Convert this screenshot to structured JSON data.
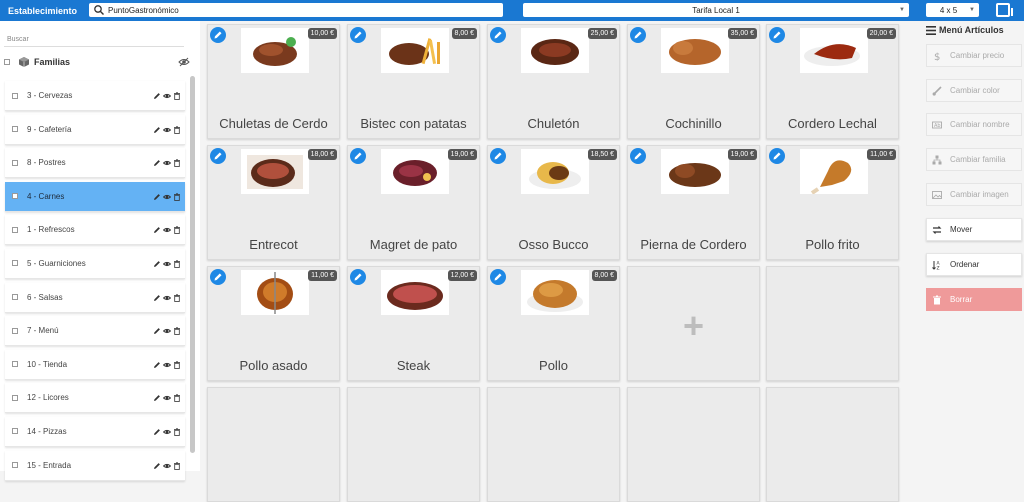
{
  "topbar": {
    "establecimiento_label": "Establecimiento",
    "establecimiento_value": "PuntoGastronómico",
    "tarifa": "Tarifa Local 1",
    "grid_size": "4 x 5"
  },
  "sidebar": {
    "search_placeholder": "Buscar",
    "familias_title": "Familias",
    "items": [
      {
        "label": "3 - Cervezas"
      },
      {
        "label": "9 - Cafetería"
      },
      {
        "label": "8 - Postres"
      },
      {
        "label": "4 - Carnes"
      },
      {
        "label": "1 - Refrescos"
      },
      {
        "label": "5 - Guarniciones"
      },
      {
        "label": "6 - Salsas"
      },
      {
        "label": "7 - Menú"
      },
      {
        "label": "10 - Tienda"
      },
      {
        "label": "12 - Licores"
      },
      {
        "label": "14 - Pizzas"
      },
      {
        "label": "15 - Entrada"
      }
    ],
    "selected_item": "4 - Carnes"
  },
  "products": [
    {
      "name": "Chuletas de Cerdo",
      "price": "10,00 €"
    },
    {
      "name": "Bistec con patatas",
      "price": "8,00 €"
    },
    {
      "name": "Chuletón",
      "price": "25,00 €"
    },
    {
      "name": "Cochinillo",
      "price": "35,00 €"
    },
    {
      "name": "Cordero Lechal",
      "price": "20,00 €"
    },
    {
      "name": "Entrecot",
      "price": "18,00 €"
    },
    {
      "name": "Magret de pato",
      "price": "19,00 €"
    },
    {
      "name": "Osso Bucco",
      "price": "18,50 €"
    },
    {
      "name": "Pierna de Cordero",
      "price": "19,00 €"
    },
    {
      "name": "Pollo frito",
      "price": "11,00 €"
    },
    {
      "name": "Pollo asado",
      "price": "11,00 €"
    },
    {
      "name": "Steak",
      "price": "12,00 €"
    },
    {
      "name": "Pollo",
      "price": "8,00 €"
    }
  ],
  "add_tile": {
    "symbol": "+"
  },
  "right_panel": {
    "title": "Menú Artículos",
    "buttons": {
      "cambiar_precio": "Cambiar precio",
      "cambiar_color": "Cambiar color",
      "cambiar_nombre": "Cambiar nombre",
      "cambiar_familia": "Cambiar familia",
      "cambiar_imagen": "Cambiar imagen",
      "mover": "Mover",
      "ordenar": "Ordenar",
      "borrar": "Borrar"
    }
  },
  "colors": {
    "topbar": "#1a78d2",
    "selected_family": "#64b2f4",
    "edit_badge": "#1e88e5",
    "price_badge": "#555555",
    "delete_button": "#ef9a9a"
  }
}
